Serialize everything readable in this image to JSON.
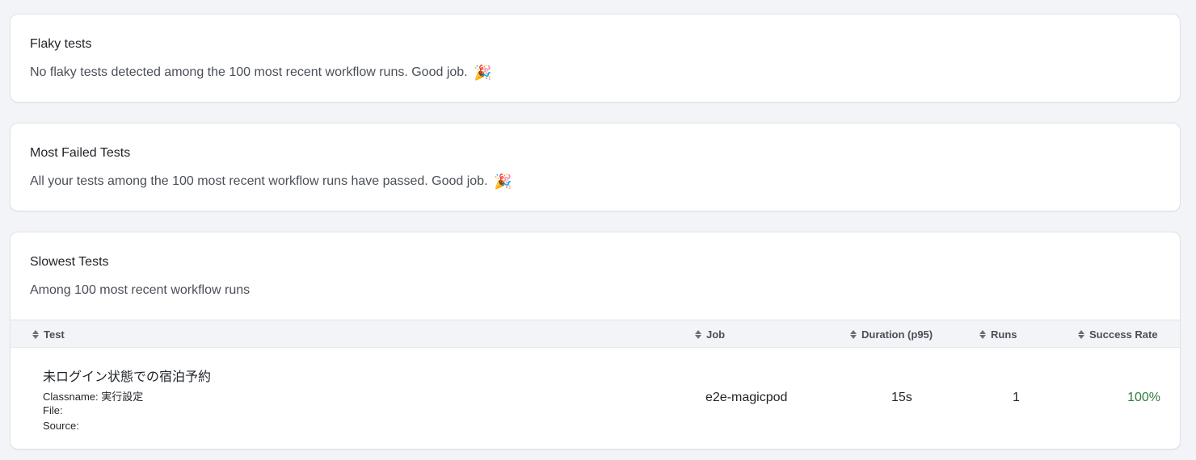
{
  "flaky": {
    "title": "Flaky tests",
    "text": "No flaky tests detected among the 100 most recent workflow runs. Good job.",
    "emoji": "🎉"
  },
  "failed": {
    "title": "Most Failed Tests",
    "text": "All your tests among the 100 most recent workflow runs have passed. Good job.",
    "emoji": "🎉"
  },
  "slowest": {
    "title": "Slowest Tests",
    "subtitle": "Among 100 most recent workflow runs",
    "columns": {
      "test": "Test",
      "job": "Job",
      "duration": "Duration (p95)",
      "runs": "Runs",
      "success": "Success Rate"
    },
    "rows": [
      {
        "name": "未ログイン状態での宿泊予約",
        "classname": "Classname: 実行設定",
        "file": "File:",
        "source": "Source:",
        "job": "e2e-magicpod",
        "duration": "15s",
        "runs": "1",
        "success": "100%"
      }
    ]
  },
  "colors": {
    "background": "#f3f4f7",
    "card": "#ffffff",
    "success_green": "#2e7d3a"
  },
  "icons": {
    "sort": "sort-icon",
    "celebration": "party-popper-icon"
  }
}
